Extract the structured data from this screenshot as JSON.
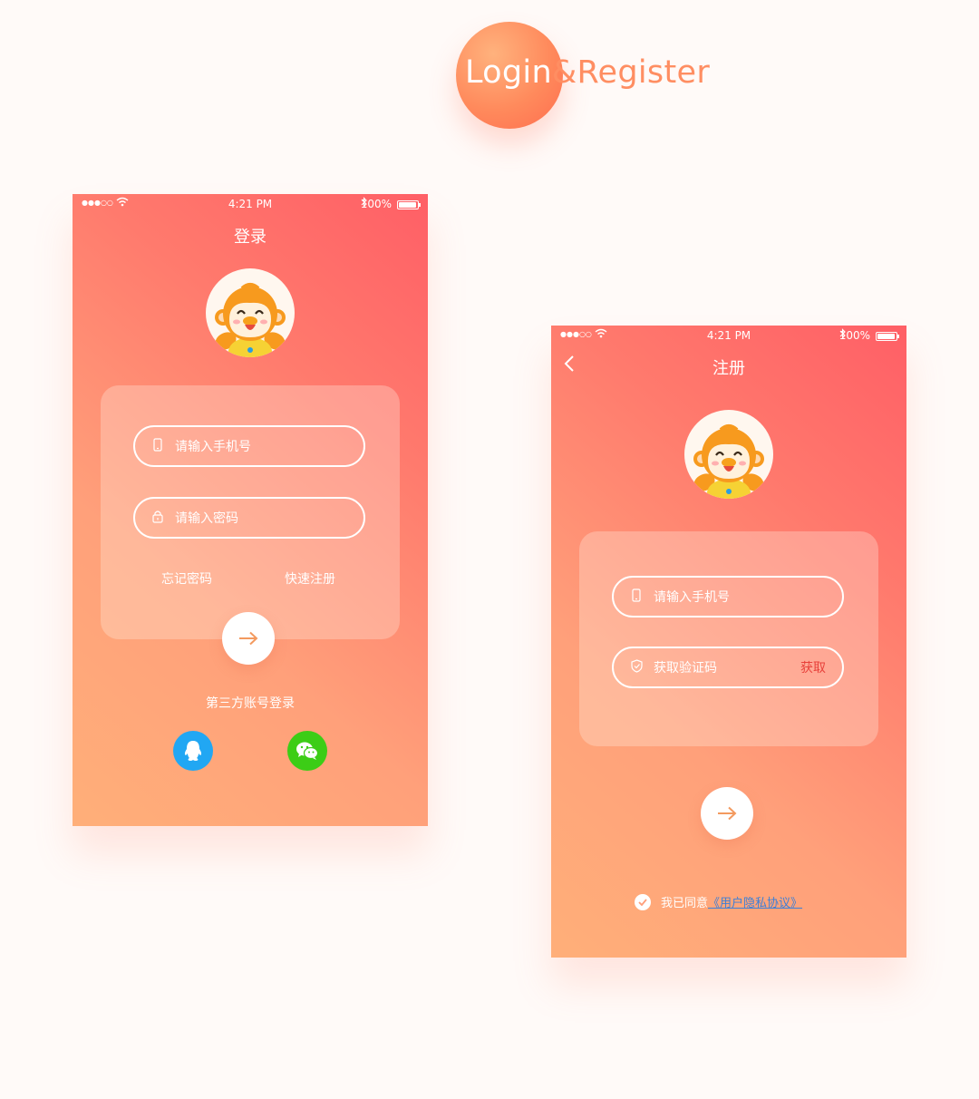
{
  "header": {
    "title_part1": "Login",
    "title_part2": "&Register"
  },
  "colors": {
    "gradient_start": "#ffaf79",
    "gradient_end": "#ff5f66",
    "accent": "#ff8e62",
    "link": "#3d7fd6",
    "action_red": "#e8413a",
    "qq_blue": "#21a7f3",
    "wechat_green": "#3ccd16"
  },
  "statusbar": {
    "time": "4:21 PM",
    "battery": "100%"
  },
  "login": {
    "nav_title": "登录",
    "phone_placeholder": "请输入手机号",
    "password_placeholder": "请输入密码",
    "forgot_password": "忘记密码",
    "quick_register": "快速注册",
    "third_party_label": "第三方账号登录",
    "icons": [
      "phone-icon",
      "lock-icon",
      "arrow-right-icon",
      "qq-icon",
      "wechat-icon"
    ]
  },
  "register": {
    "nav_title": "注册",
    "phone_placeholder": "请输入手机号",
    "code_placeholder": "获取验证码",
    "get_code_action": "获取",
    "agree_text": "我已同意",
    "agreement_link": "《用户隐私协议》",
    "icons": [
      "back-chevron-icon",
      "phone-icon",
      "shield-icon",
      "arrow-right-icon",
      "check-icon"
    ]
  }
}
